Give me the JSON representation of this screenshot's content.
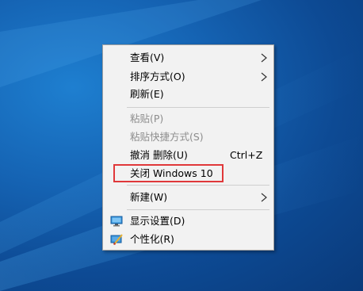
{
  "context_menu": {
    "items": [
      {
        "label": "查看(V)",
        "has_submenu": true,
        "enabled": true
      },
      {
        "label": "排序方式(O)",
        "has_submenu": true,
        "enabled": true
      },
      {
        "label": "刷新(E)",
        "enabled": true
      },
      {
        "label": "粘贴(P)",
        "enabled": false
      },
      {
        "label": "粘贴快捷方式(S)",
        "enabled": false
      },
      {
        "label": "撤消 删除(U)",
        "shortcut": "Ctrl+Z",
        "enabled": true
      },
      {
        "label": "关闭 Windows 10",
        "enabled": true,
        "highlighted": true
      },
      {
        "label": "新建(W)",
        "has_submenu": true,
        "enabled": true
      },
      {
        "label": "显示设置(D)",
        "icon": "display-settings-icon",
        "enabled": true
      },
      {
        "label": "个性化(R)",
        "icon": "personalize-icon",
        "enabled": true
      }
    ]
  },
  "colors": {
    "highlight_border": "#e0383a",
    "desktop_blue": "#1563b3"
  }
}
